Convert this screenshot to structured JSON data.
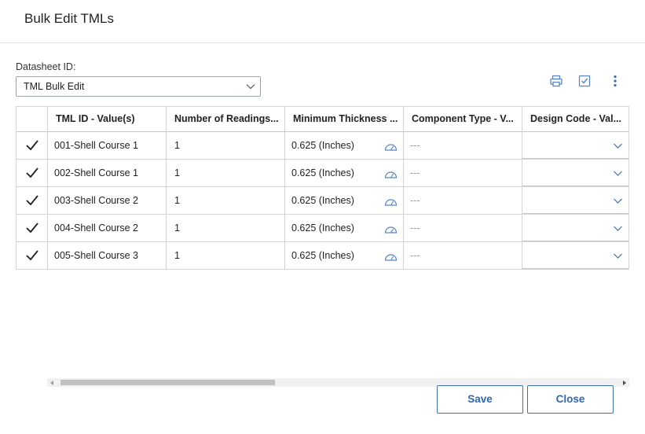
{
  "dialog": {
    "title": "Bulk Edit TMLs"
  },
  "datasheet": {
    "label": "Datasheet ID:",
    "value": "TML Bulk Edit"
  },
  "toolbar": {
    "icons": [
      "print-icon",
      "checkbox-icon",
      "more-vertical-icon"
    ]
  },
  "colors": {
    "accent": "#2f67b2",
    "border": "#d4d4d4",
    "icon": "#5a86c5"
  },
  "table": {
    "columns": [
      "",
      "TML ID - Value(s)",
      "Number of Readings...",
      "Minimum Thickness ...",
      "Component Type - V...",
      "Design Code - Val..."
    ],
    "rows": [
      {
        "tml_id": "001-Shell Course 1",
        "readings": "1",
        "min_thickness": "0.625 (Inches)",
        "component_type": "---",
        "design_code": ""
      },
      {
        "tml_id": "002-Shell Course 1",
        "readings": "1",
        "min_thickness": "0.625 (Inches)",
        "component_type": "---",
        "design_code": ""
      },
      {
        "tml_id": "003-Shell Course 2",
        "readings": "1",
        "min_thickness": "0.625 (Inches)",
        "component_type": "---",
        "design_code": ""
      },
      {
        "tml_id": "004-Shell Course 2",
        "readings": "1",
        "min_thickness": "0.625 (Inches)",
        "component_type": "---",
        "design_code": ""
      },
      {
        "tml_id": "005-Shell Course 3",
        "readings": "1",
        "min_thickness": "0.625 (Inches)",
        "component_type": "---",
        "design_code": ""
      }
    ]
  },
  "footer": {
    "save_label": "Save",
    "close_label": "Close"
  }
}
